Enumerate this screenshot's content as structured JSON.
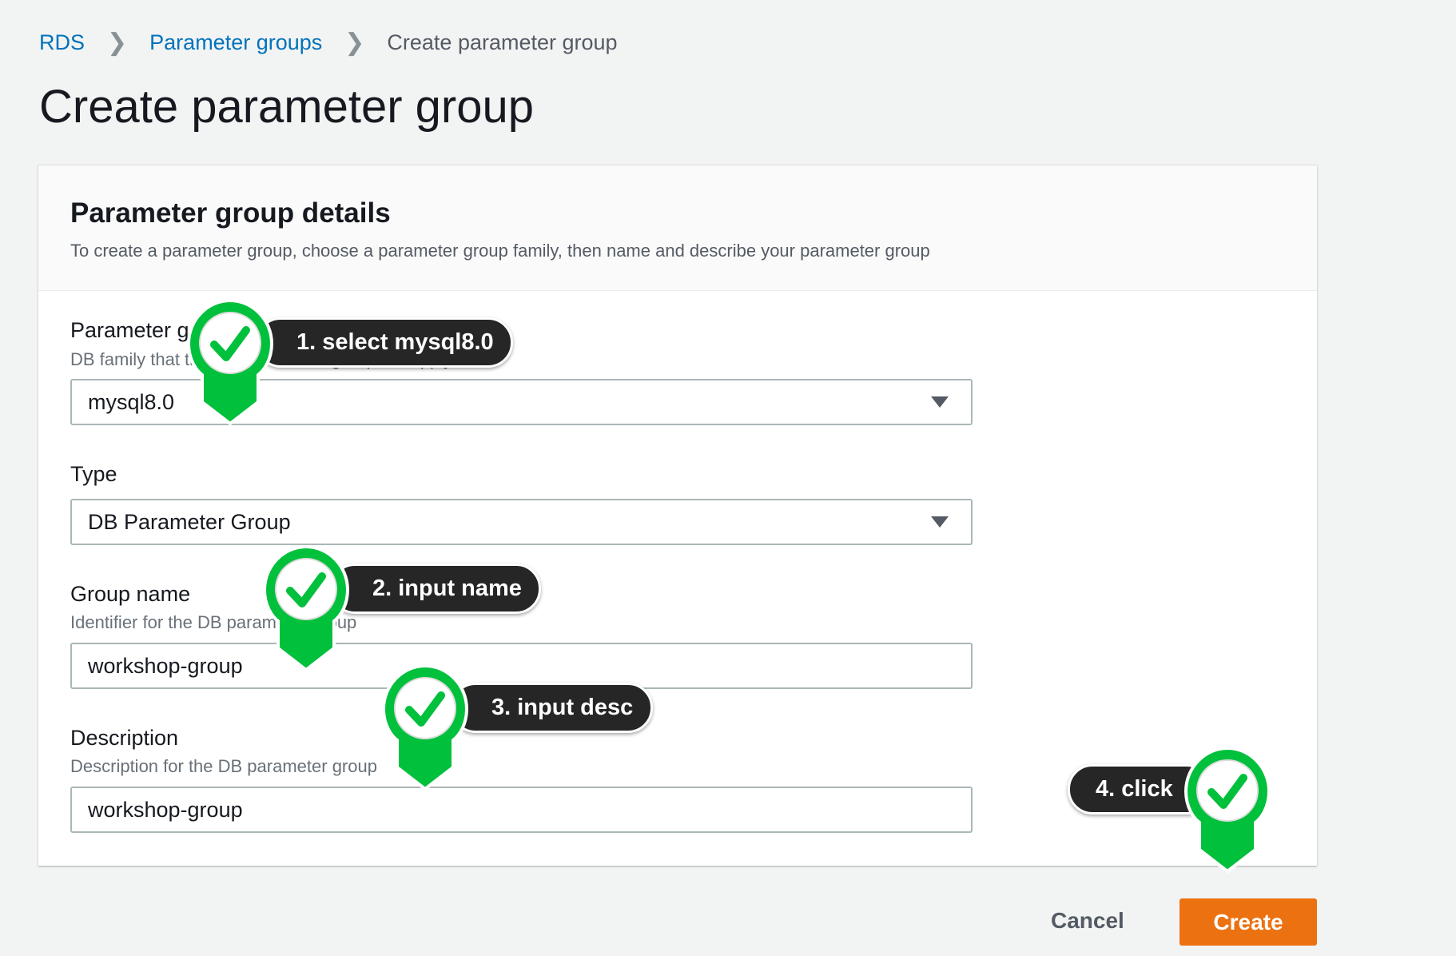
{
  "breadcrumb": {
    "items": [
      {
        "label": "RDS"
      },
      {
        "label": "Parameter groups"
      }
    ],
    "current": "Create parameter group"
  },
  "page_title": "Create parameter group",
  "panel": {
    "title": "Parameter group details",
    "subtitle": "To create a parameter group, choose a parameter group family, then name and describe your parameter group",
    "family": {
      "label": "Parameter group family",
      "description": "DB family that this DB parameter group will apply to",
      "value": "mysql8.0"
    },
    "type": {
      "label": "Type",
      "value": "DB Parameter Group"
    },
    "group_name": {
      "label": "Group name",
      "description": "Identifier for the DB parameter group",
      "value": "workshop-group"
    },
    "description": {
      "label": "Description",
      "description": "Description for the DB parameter group",
      "value": "workshop-group"
    }
  },
  "actions": {
    "cancel": "Cancel",
    "create": "Create"
  },
  "annotations": [
    {
      "text": "1. select mysql8.0"
    },
    {
      "text": "2. input name"
    },
    {
      "text": "3. input desc"
    },
    {
      "text": "4. click"
    }
  ],
  "colors": {
    "link": "#0073bb",
    "primary": "#ec7211",
    "marker": "#00c03c",
    "bubble": "#262626"
  }
}
